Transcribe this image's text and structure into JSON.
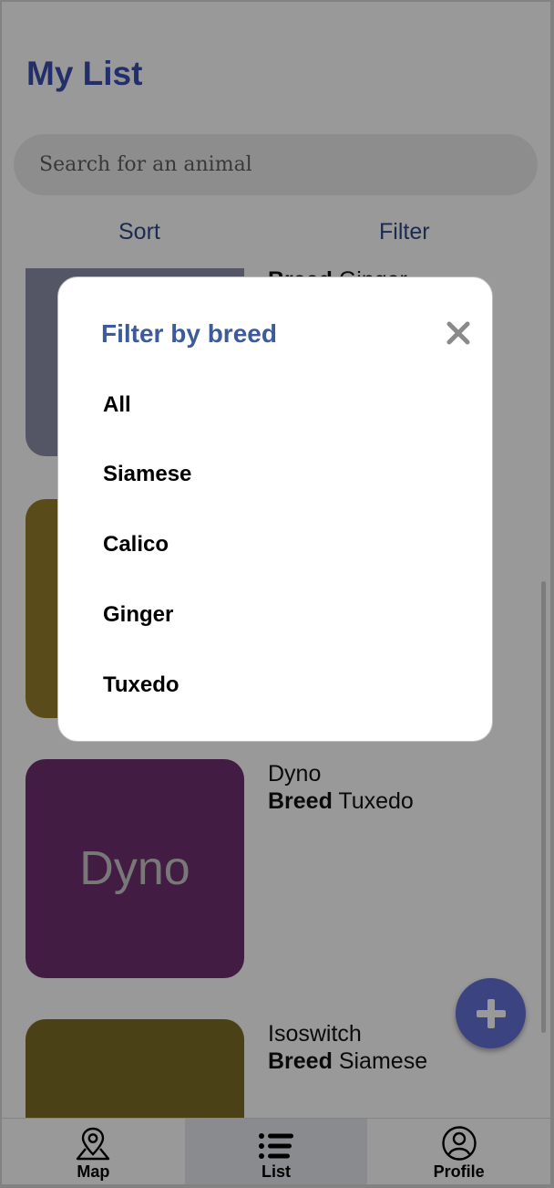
{
  "header": {
    "title": "My List"
  },
  "search": {
    "placeholder": "Search for an animal"
  },
  "controls": {
    "sort_label": "Sort",
    "filter_label": "Filter"
  },
  "animals": [
    {
      "name": "",
      "breed_label": "Breed",
      "breed": "Ginger",
      "thumb_label": "",
      "color": "#8c90a8"
    },
    {
      "name": "",
      "breed_label": "Breed",
      "breed": "",
      "thumb_label": "",
      "color": "#977f2c"
    },
    {
      "name": "Dyno",
      "breed_label": "Breed",
      "breed": "Tuxedo",
      "thumb_label": "Dyno",
      "color": "#6f2f6f"
    },
    {
      "name": "Isoswitch",
      "breed_label": "Breed",
      "breed": "Siamese",
      "thumb_label": "",
      "color": "#7c6e25"
    }
  ],
  "fab": {
    "icon": "plus-icon"
  },
  "nav": {
    "items": [
      {
        "label": "Map",
        "icon": "map-pin-icon"
      },
      {
        "label": "List",
        "icon": "list-icon"
      },
      {
        "label": "Profile",
        "icon": "profile-icon"
      }
    ],
    "active": "List"
  },
  "filter_modal": {
    "title": "Filter by breed",
    "options": [
      "All",
      "Siamese",
      "Calico",
      "Ginger",
      "Tuxedo"
    ]
  },
  "colors": {
    "accent": "#3b4fb1",
    "fab": "#6371d6",
    "modal_title": "#3d5a99"
  }
}
